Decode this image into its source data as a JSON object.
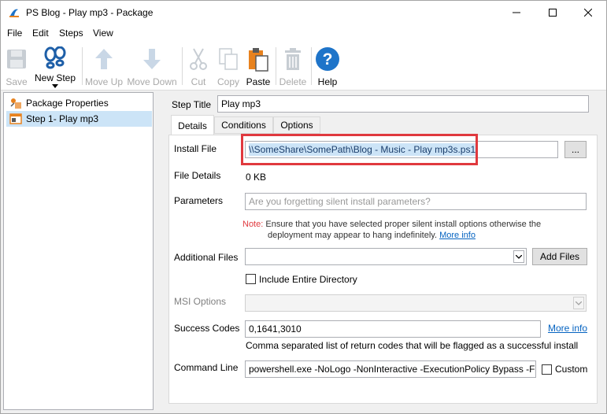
{
  "window": {
    "title": "PS Blog - Play mp3 - Package",
    "minimize_glyph": "—",
    "maximize_glyph": "☐",
    "close_glyph": "✕"
  },
  "menu": [
    "File",
    "Edit",
    "Steps",
    "View"
  ],
  "toolbar": {
    "save": "Save",
    "new_step": "New Step",
    "move_up": "Move Up",
    "move_down": "Move Down",
    "cut": "Cut",
    "copy": "Copy",
    "paste": "Paste",
    "delete": "Delete",
    "help": "Help"
  },
  "tree": {
    "items": [
      {
        "label": "Package Properties",
        "icon": "package-icon"
      },
      {
        "label": "Step 1- Play mp3",
        "icon": "step-icon",
        "selected": true
      }
    ]
  },
  "step": {
    "title_label": "Step Title",
    "title_value": "Play mp3"
  },
  "tabs": [
    {
      "label": "Details",
      "active": true
    },
    {
      "label": "Conditions"
    },
    {
      "label": "Options"
    }
  ],
  "details": {
    "install_file_label": "Install File",
    "install_file_value": "\\\\SomeShare\\SomePath\\Blog - Music - Play mp3s.ps1",
    "browse_label": "...",
    "file_details_label": "File Details",
    "file_details_value": "0 KB",
    "parameters_label": "Parameters",
    "parameters_placeholder": "Are you forgetting silent install parameters?",
    "note_prefix": "Note:",
    "note_line1": "Ensure that you have selected proper silent install options otherwise the",
    "note_line2": "deployment may appear to hang indefinitely.",
    "more_info_1": "More info",
    "additional_files_label": "Additional Files",
    "add_files_label": "Add Files",
    "include_dir_label": "Include Entire Directory",
    "msi_options_label": "MSI Options",
    "success_codes_label": "Success Codes",
    "success_codes_value": "0,1641,3010",
    "more_info_2": "More info",
    "success_codes_help": "Comma separated list of return codes that will be flagged as a successful install",
    "command_line_label": "Command Line",
    "command_line_value": "powershell.exe -NoLogo -NonInteractive -ExecutionPolicy Bypass -Fil",
    "custom_label": "Custom"
  },
  "colors": {
    "highlight_border": "#e0393e",
    "note_red": "#e0393e",
    "link_blue": "#0563c1",
    "selection_blue": "#cce4f7",
    "help_blue": "#1e74c9",
    "paste_orange": "#e8821e"
  }
}
